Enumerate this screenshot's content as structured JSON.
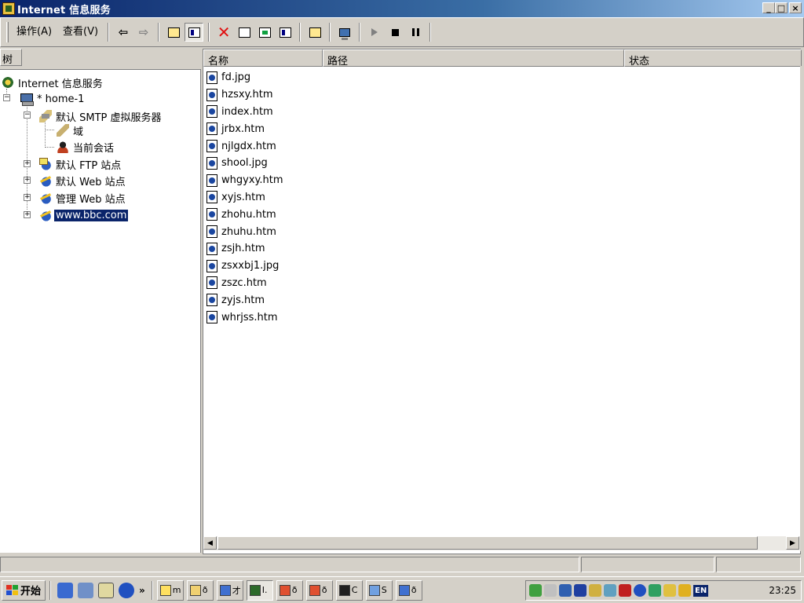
{
  "window": {
    "title": "Internet 信息服务"
  },
  "window_buttons": {
    "minimize": "_",
    "maximize": "□",
    "close": "×"
  },
  "menu": {
    "items": [
      "操作(A)",
      "查看(V)"
    ]
  },
  "toolbar": {
    "buttons": [
      {
        "name": "back-button",
        "icon": "back-arrow-icon"
      },
      {
        "name": "forward-button",
        "icon": "forward-arrow-icon"
      },
      {
        "name": "up-one-level-button",
        "icon": "folder-up-icon"
      },
      {
        "name": "show-hide-tree-button",
        "icon": "tree-toggle-icon",
        "pressed": true
      },
      {
        "name": "delete-button",
        "icon": "delete-x-icon"
      },
      {
        "name": "properties-button",
        "icon": "properties-icon"
      },
      {
        "name": "refresh-button",
        "icon": "refresh-icon"
      },
      {
        "name": "export-list-button",
        "icon": "export-icon"
      },
      {
        "name": "help-button",
        "icon": "help-icon"
      },
      {
        "name": "computer-button",
        "icon": "computer-icon"
      },
      {
        "name": "start-button",
        "icon": "play-icon"
      },
      {
        "name": "stop-button",
        "icon": "stop-icon"
      },
      {
        "name": "pause-button",
        "icon": "pause-icon"
      }
    ]
  },
  "tree": {
    "header": "树",
    "nodes": [
      {
        "label": "Internet 信息服务",
        "icon": "iis-icon"
      },
      {
        "label": "* home-1",
        "icon": "computer-icon"
      },
      {
        "label": "默认 SMTP 虚拟服务器",
        "icon": "smtp-server-icon"
      },
      {
        "label": "域",
        "icon": "domain-icon"
      },
      {
        "label": "当前会话",
        "icon": "session-icon"
      },
      {
        "label": "默认 FTP 站点",
        "icon": "ftp-site-icon"
      },
      {
        "label": "默认 Web 站点",
        "icon": "web-site-icon"
      },
      {
        "label": "管理 Web 站点",
        "icon": "web-site-icon"
      },
      {
        "label": "www.bbc.com",
        "icon": "web-site-icon",
        "selected": true
      }
    ]
  },
  "list": {
    "columns": [
      "名称",
      "路径",
      "状态"
    ],
    "files": [
      "fd.jpg",
      "hzsxy.htm",
      "index.htm",
      "jrbx.htm",
      "njlgdx.htm",
      "shool.jpg",
      "whgyxy.htm",
      "xyjs.htm",
      "zhohu.htm",
      "zhuhu.htm",
      "zsjh.htm",
      "zsxxbj1.jpg",
      "zszc.htm",
      "zyjs.htm",
      "whrjss.htm"
    ]
  },
  "taskbar": {
    "start_label": "开始",
    "chevron": "»",
    "tasks": [
      "m",
      "ð",
      "才",
      "I.",
      "ð",
      "ð",
      "C",
      "S",
      "ð"
    ],
    "clock": "23:25",
    "language": "EN"
  }
}
